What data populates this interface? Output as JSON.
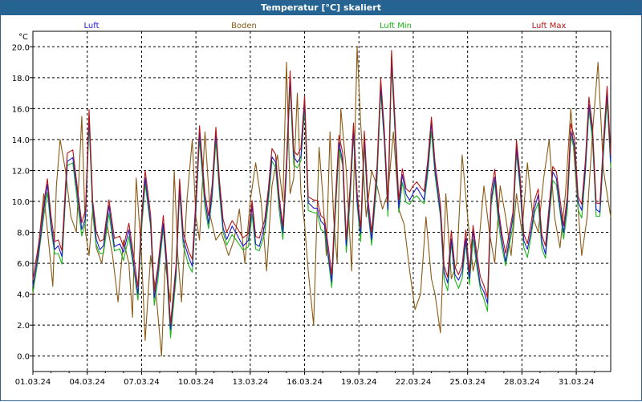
{
  "window": {
    "title": "Temperatur [°C] skaliert"
  },
  "chart_data": {
    "type": "line",
    "title": "Temperatur [°C] skaliert",
    "ylabel": "°C",
    "xlabel": "",
    "ylim": [
      -1.0,
      21.0
    ],
    "yticks": [
      0.0,
      2.0,
      4.0,
      6.0,
      8.0,
      10.0,
      12.0,
      14.0,
      16.0,
      18.0,
      20.0
    ],
    "ytick_labels": [
      "0.0",
      "2.0",
      "4.0",
      "6.0",
      "8.0",
      "10.0",
      "12.0",
      "14.0",
      "16.0",
      "18.0",
      "20.0"
    ],
    "xlim": [
      0,
      31.9
    ],
    "xticks": [
      0,
      3,
      6,
      9,
      12,
      15,
      18,
      21,
      24,
      27,
      30
    ],
    "xtick_labels": [
      "01.03.24",
      "04.03.24",
      "07.03.24",
      "10.03.24",
      "13.03.24",
      "16.03.24",
      "19.03.24",
      "22.03.24",
      "25.03.24",
      "28.03.24",
      "31.03.24"
    ],
    "grid": true,
    "legend_position": "top",
    "luft_base": {
      "x": [
        0,
        0.3,
        0.6,
        0.8,
        1.0,
        1.2,
        1.4,
        1.6,
        1.9,
        2.2,
        2.5,
        2.7,
        2.9,
        3.1,
        3.3,
        3.5,
        3.7,
        3.9,
        4.2,
        4.5,
        4.8,
        5.0,
        5.3,
        5.6,
        5.8,
        6.0,
        6.2,
        6.5,
        6.7,
        6.9,
        7.2,
        7.4,
        7.6,
        7.9,
        8.1,
        8.3,
        8.6,
        8.8,
        9.0,
        9.2,
        9.5,
        9.7,
        9.9,
        10.1,
        10.3,
        10.5,
        10.7,
        11.0,
        11.3,
        11.6,
        11.9,
        12.1,
        12.3,
        12.5,
        12.8,
        13.0,
        13.2,
        13.4,
        13.6,
        13.8,
        14.0,
        14.2,
        14.4,
        14.6,
        14.8,
        15.0,
        15.2,
        15.5,
        15.7,
        15.9,
        16.1,
        16.3,
        16.5,
        16.7,
        16.9,
        17.1,
        17.3,
        17.5,
        17.7,
        17.9,
        18.1,
        18.3,
        18.5,
        18.7,
        19.0,
        19.2,
        19.4,
        19.6,
        19.8,
        20.0,
        20.2,
        20.4,
        20.6,
        20.8,
        21.0,
        21.2,
        21.4,
        21.6,
        21.8,
        22.0,
        22.2,
        22.5,
        22.7,
        22.9,
        23.1,
        23.3,
        23.5,
        23.7,
        23.9,
        24.1,
        24.3,
        24.5,
        24.7,
        24.9,
        25.1,
        25.3,
        25.5,
        25.7,
        25.9,
        26.1,
        26.3,
        26.5,
        26.7,
        26.9,
        27.1,
        27.3,
        27.5,
        27.7,
        27.9,
        28.1,
        28.3,
        28.5,
        28.7,
        28.9,
        29.1,
        29.3,
        29.5,
        29.7,
        29.9,
        30.1,
        30.3,
        30.5,
        30.7,
        30.9,
        31.1,
        31.3,
        31.5,
        31.7,
        31.9
      ],
      "y": [
        4.5,
        6.5,
        9.5,
        11.2,
        8.5,
        6.8,
        7.2,
        6.5,
        12.5,
        12.8,
        10.2,
        8.2,
        8.8,
        15.5,
        9.8,
        7.5,
        6.8,
        7.2,
        9.8,
        7.0,
        7.2,
        6.8,
        8.2,
        5.5,
        4.0,
        8.8,
        11.5,
        8.5,
        3.8,
        5.5,
        8.5,
        5.5,
        1.8,
        5.5,
        10.8,
        7.5,
        6.5,
        5.8,
        9.5,
        14.5,
        10.2,
        8.5,
        10.5,
        14.5,
        11.0,
        8.2,
        7.5,
        8.5,
        7.8,
        7.0,
        7.5,
        9.8,
        7.2,
        7.0,
        8.5,
        10.5,
        12.8,
        12.5,
        10.0,
        8.0,
        12.0,
        18.0,
        13.0,
        12.5,
        12.8,
        16.5,
        10.0,
        9.5,
        9.5,
        8.8,
        8.5,
        6.5,
        4.8,
        9.8,
        13.8,
        12.5,
        7.2,
        10.5,
        14.5,
        10.0,
        8.0,
        14.2,
        9.5,
        7.5,
        12.0,
        17.5,
        14.0,
        9.5,
        19.5,
        14.5,
        9.5,
        11.8,
        10.5,
        10.0,
        10.5,
        11.0,
        10.5,
        10.0,
        12.2,
        15.2,
        12.0,
        9.2,
        5.5,
        4.8,
        7.5,
        5.2,
        5.0,
        5.5,
        7.5,
        5.0,
        8.2,
        6.2,
        4.5,
        4.2,
        3.5,
        10.0,
        11.5,
        9.2,
        7.5,
        6.0,
        7.5,
        9.0,
        13.5,
        11.0,
        7.5,
        7.0,
        8.0,
        9.5,
        10.5,
        7.5,
        6.5,
        9.2,
        12.0,
        11.5,
        9.5,
        8.0,
        10.0,
        14.5,
        13.5,
        10.0,
        9.5,
        12.0,
        16.2,
        14.5,
        9.5,
        9.2,
        13.5,
        17.2,
        12.5,
        11.2
      ]
    },
    "series": [
      {
        "name": "Luft",
        "color": "#1c1cd2",
        "offset": 0.0,
        "wiggle": 0.1
      },
      {
        "name": "Boden",
        "color": "#8b5a14",
        "offset": -0.25,
        "wiggle": 0.0
      },
      {
        "name": "Luft Min",
        "color": "#18b418",
        "offset": -0.4,
        "wiggle": 0.25
      },
      {
        "name": "Luft Max",
        "color": "#b41414",
        "offset": 0.45,
        "wiggle": 0.2
      }
    ],
    "boden_points": {
      "x": [
        0,
        0.3,
        0.6,
        0.9,
        1.1,
        1.3,
        1.5,
        1.8,
        2.1,
        2.4,
        2.7,
        2.9,
        3.1,
        3.3,
        3.5,
        3.8,
        4.1,
        4.4,
        4.7,
        5.0,
        5.3,
        5.5,
        5.7,
        6.0,
        6.2,
        6.5,
        6.8,
        7.1,
        7.3,
        7.6,
        7.8,
        8.0,
        8.2,
        8.5,
        8.8,
        9.0,
        9.2,
        9.5,
        9.8,
        10.1,
        10.4,
        10.8,
        11.1,
        11.4,
        11.7,
        12.0,
        12.3,
        12.6,
        12.9,
        13.2,
        13.5,
        13.8,
        14.0,
        14.2,
        14.4,
        14.6,
        14.8,
        15.0,
        15.2,
        15.5,
        15.8,
        16.0,
        16.2,
        16.4,
        16.6,
        16.8,
        17.0,
        17.3,
        17.6,
        17.9,
        18.1,
        18.4,
        18.7,
        19.0,
        19.3,
        19.6,
        19.9,
        20.2,
        20.5,
        20.8,
        21.1,
        21.4,
        21.7,
        22.0,
        22.2,
        22.5,
        22.8,
        23.1,
        23.4,
        23.7,
        24.0,
        24.3,
        24.6,
        24.9,
        25.2,
        25.5,
        25.8,
        26.1,
        26.4,
        26.7,
        27.0,
        27.3,
        27.6,
        27.9,
        28.2,
        28.5,
        28.8,
        29.1,
        29.4,
        29.7,
        30.0,
        30.3,
        30.6,
        30.9,
        31.2,
        31.5,
        31.9
      ],
      "y": [
        4.0,
        7.0,
        10.5,
        7.0,
        4.5,
        11.0,
        14.0,
        12.0,
        9.0,
        8.0,
        15.5,
        8.0,
        6.5,
        9.5,
        7.0,
        6.0,
        8.5,
        6.5,
        3.5,
        7.5,
        6.0,
        2.5,
        11.5,
        6.5,
        1.0,
        6.5,
        4.0,
        0.0,
        6.0,
        3.5,
        12.0,
        6.5,
        3.5,
        10.0,
        14.0,
        9.0,
        7.5,
        14.5,
        9.0,
        7.5,
        8.0,
        6.5,
        7.5,
        9.5,
        6.0,
        10.0,
        12.5,
        10.0,
        5.5,
        11.0,
        13.0,
        10.0,
        19.0,
        10.5,
        11.5,
        17.0,
        10.5,
        8.5,
        5.5,
        2.0,
        13.5,
        10.5,
        6.5,
        14.5,
        9.0,
        6.0,
        16.0,
        12.0,
        5.5,
        20.0,
        15.0,
        9.0,
        12.0,
        11.0,
        9.5,
        10.5,
        14.5,
        9.5,
        8.5,
        5.5,
        3.0,
        4.0,
        9.0,
        5.0,
        4.0,
        1.5,
        10.5,
        5.0,
        6.0,
        13.0,
        9.0,
        5.5,
        7.0,
        11.0,
        8.0,
        6.0,
        11.0,
        9.0,
        6.5,
        10.5,
        8.0,
        12.5,
        9.0,
        8.0,
        11.5,
        14.0,
        9.0,
        7.0,
        10.5,
        16.0,
        11.0,
        6.5,
        9.0,
        14.5,
        19.0,
        12.0,
        9.0
      ]
    }
  }
}
